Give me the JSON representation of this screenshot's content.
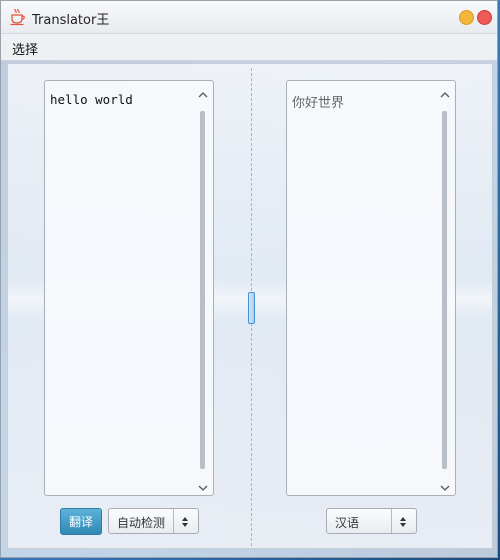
{
  "window": {
    "title": "Translator王",
    "accent_minimize": "#f5b73b",
    "accent_close": "#ee5a55"
  },
  "menu": {
    "items": [
      "选择"
    ]
  },
  "source": {
    "text": "hello world"
  },
  "target": {
    "text": "你好世界"
  },
  "controls": {
    "translate_label": "翻译",
    "source_language": "自动检测",
    "target_language": "汉语",
    "button_color": "#2f88b6"
  },
  "icons": {
    "app": "coffee-cup-icon",
    "scroll_up": "chevron-up-icon",
    "scroll_down": "chevron-down-icon",
    "combo_arrows": "up-down-arrows-icon"
  }
}
